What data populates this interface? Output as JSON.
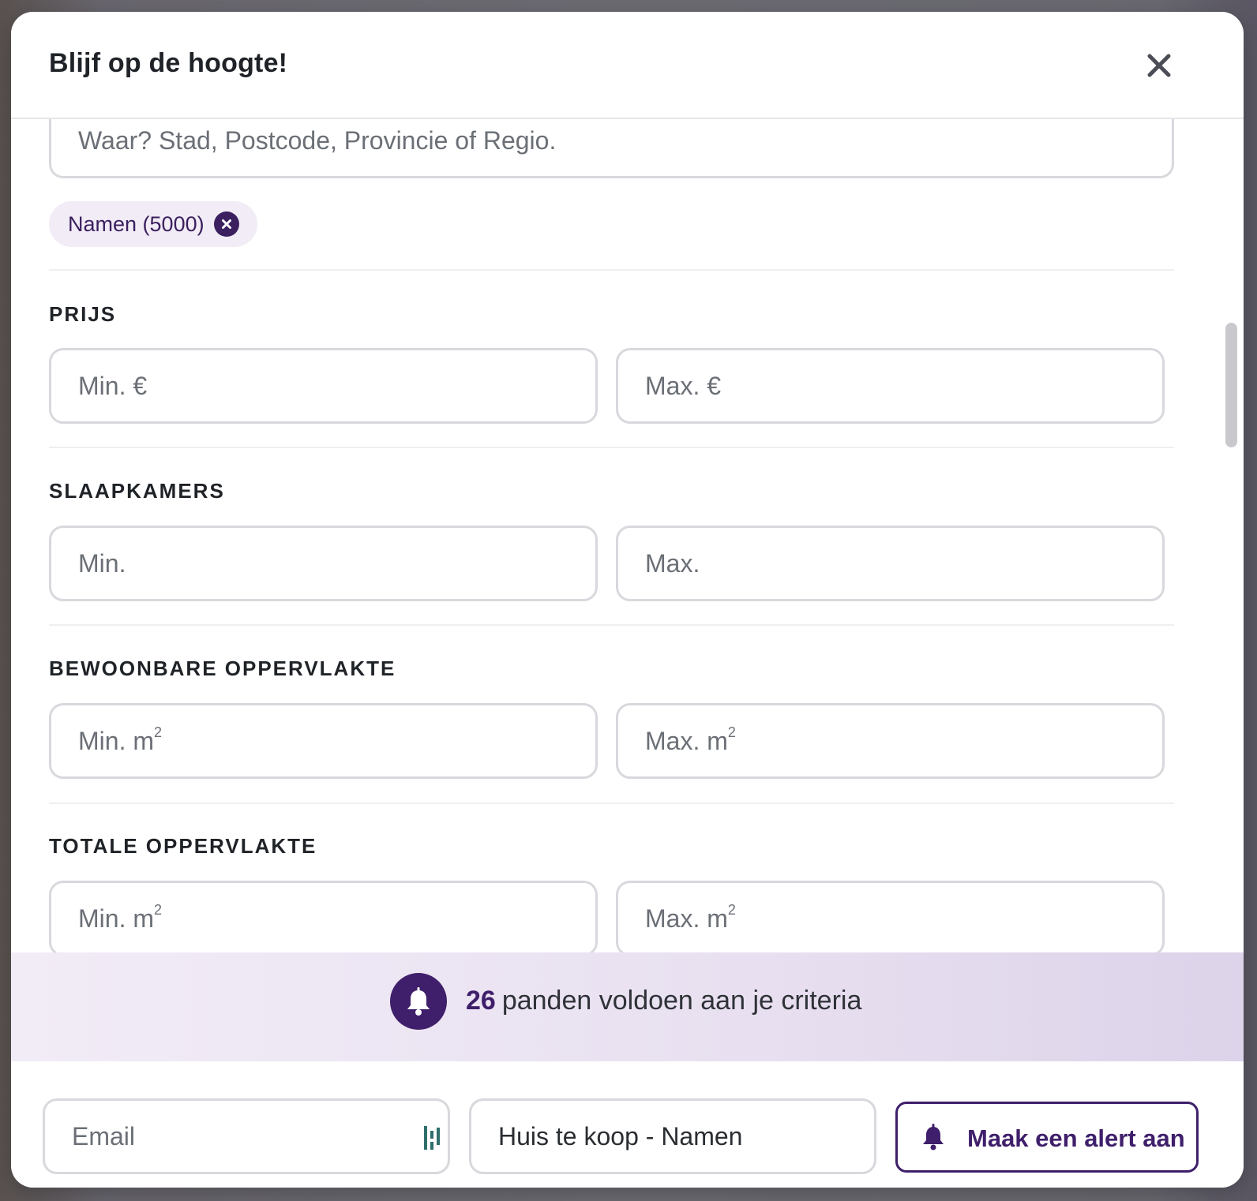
{
  "modal": {
    "title": "Blijf op de hoogte!"
  },
  "location": {
    "placeholder": "Waar? Stad, Postcode, Provincie of Regio.",
    "chip_label": "Namen (5000)"
  },
  "sections": {
    "price": {
      "label": "PRIJS",
      "min_placeholder": "Min. €",
      "max_placeholder": "Max. €"
    },
    "bedrooms": {
      "label": "SLAAPKAMERS",
      "min_placeholder": "Min.",
      "max_placeholder": "Max."
    },
    "living_area": {
      "label": "BEWOONBARE OPPERVLAKTE",
      "min_placeholder": "Min. m",
      "max_placeholder": "Max. m",
      "unit_sup": "2"
    },
    "total_area": {
      "label": "TOTALE OPPERVLAKTE",
      "min_placeholder": "Min. m",
      "max_placeholder": "Max. m",
      "unit_sup": "2"
    }
  },
  "results_banner": {
    "count": "26",
    "text": "panden voldoen aan je criteria"
  },
  "footer": {
    "email_placeholder": "Email",
    "alert_name_value": "Huis te koop - Namen",
    "create_alert_label": "Maak een alert aan"
  },
  "colors": {
    "brand_purple": "#3f1f6b",
    "chip_bg": "#f1ecf6"
  }
}
